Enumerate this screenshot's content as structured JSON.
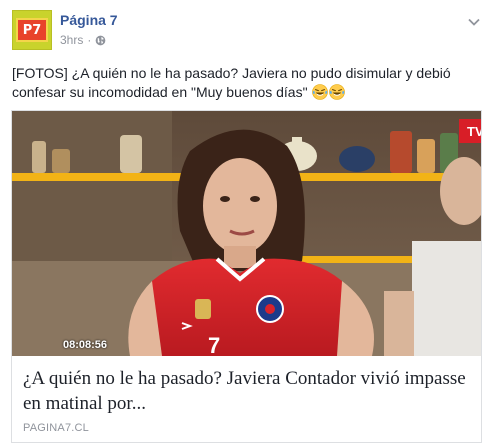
{
  "header": {
    "avatar_text": "P7",
    "page_name": "Página 7",
    "time": "3hrs",
    "separator": "·",
    "privacy_icon": "globe-icon",
    "menu_icon": "chevron-down-icon"
  },
  "post": {
    "text": "[FOTOS] ¿A quién no le ha pasado? Javiera no pudo disimular y debió confesar su incomodidad en \"Muy buenos días\"",
    "emojis": [
      "laughing-tears-emoji",
      "laughing-tears-emoji"
    ]
  },
  "link_card": {
    "video_timestamp": "08:08:56",
    "title": "¿A quién no le ha pasado? Javiera Contador vivió impasse en matinal por...",
    "domain": "PAGINA7.CL",
    "channel_badge": "TV"
  },
  "colors": {
    "link_blue": "#365899",
    "meta_gray": "#90949c",
    "jersey_red": "#d8232a",
    "shelf_yellow": "#f2b316"
  }
}
